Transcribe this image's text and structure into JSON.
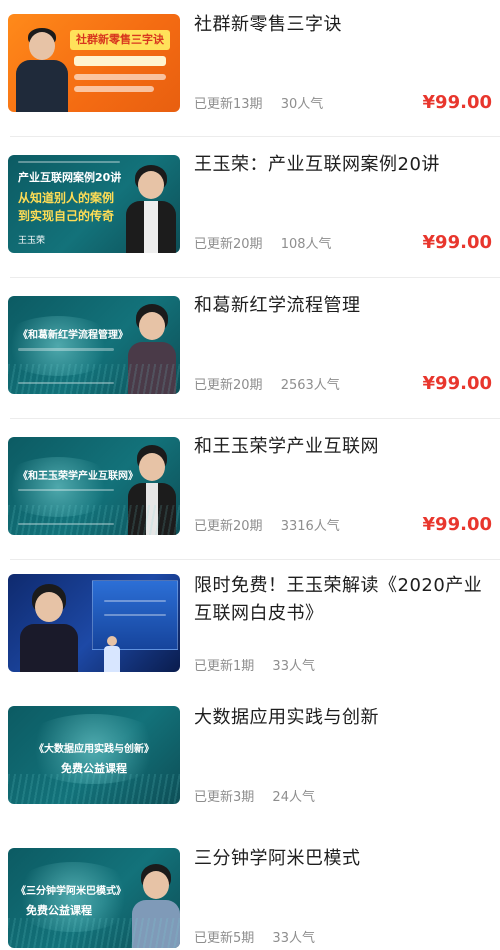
{
  "items": [
    {
      "title": "社群新零售三字诀",
      "updated": "已更新13期",
      "popularity": "30人气",
      "price": "¥99.00",
      "thumb_text": "社群新零售三字诀"
    },
    {
      "title": "王玉荣：产业互联网案例20讲",
      "updated": "已更新20期",
      "popularity": "108人气",
      "price": "¥99.00",
      "thumb_text": "产业互联网案例20讲",
      "thumb_text2": "从知道别人的案例",
      "thumb_text3": "到实现自己的传奇",
      "thumb_name": "王玉荣"
    },
    {
      "title": "和葛新红学流程管理",
      "updated": "已更新20期",
      "popularity": "2563人气",
      "price": "¥99.00",
      "thumb_text": "《和葛新红学流程管理》"
    },
    {
      "title": "和王玉荣学产业互联网",
      "updated": "已更新20期",
      "popularity": "3316人气",
      "price": "¥99.00",
      "thumb_text": "《和王玉荣学产业互联网》"
    },
    {
      "title": "限时免费！王玉荣解读《2020产业互联网白皮书》",
      "updated": "已更新1期",
      "popularity": "33人气",
      "price": ""
    },
    {
      "title": "大数据应用实践与创新",
      "updated": "已更新3期",
      "popularity": "24人气",
      "price": "",
      "thumb_text": "《大数据应用实践与创新》",
      "thumb_sub": "免费公益课程"
    },
    {
      "title": "三分钟学阿米巴模式",
      "updated": "已更新5期",
      "popularity": "33人气",
      "price": "",
      "thumb_text": "《三分钟学阿米巴模式》",
      "thumb_sub": "免费公益课程"
    }
  ],
  "colors": {
    "price": "#e8362d",
    "meta": "#8e8e8e",
    "title": "#1e1e1e"
  }
}
